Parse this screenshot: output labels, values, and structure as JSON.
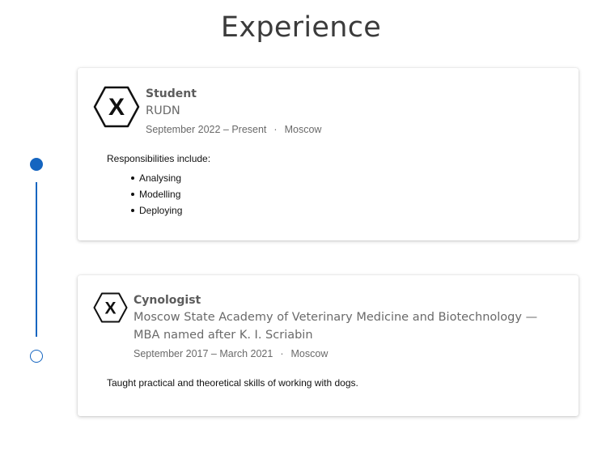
{
  "section": {
    "title": "Experience"
  },
  "colors": {
    "accent": "#1565c0",
    "title": "#3b3b3b",
    "muted": "#6a6a6a"
  },
  "timeline": {
    "markers": [
      "filled",
      "hollow"
    ]
  },
  "entries": [
    {
      "logo_icon": "hexagon-x-icon",
      "logo_letter": "X",
      "role": "Student",
      "organization": "RUDN",
      "dates": "September 2022 – Present",
      "separator": "·",
      "location": "Moscow",
      "description_intro": "Responsibilities include:",
      "responsibilities": [
        "Analysing",
        "Modelling",
        "Deploying"
      ]
    },
    {
      "logo_icon": "hexagon-x-icon",
      "logo_letter": "X",
      "role": "Cynologist",
      "organization": "Moscow State Academy of Veterinary Medicine and Biotechnology — MBA named after K. I. Scriabin",
      "dates": "September 2017 – March 2021",
      "separator": "·",
      "location": "Moscow",
      "description": "Taught practical and theoretical skills of working with dogs."
    }
  ]
}
